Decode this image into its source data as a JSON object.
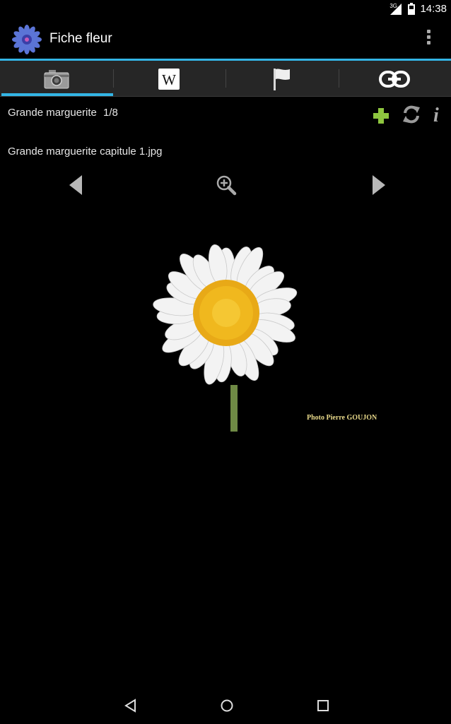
{
  "status_bar": {
    "network": "3G",
    "time": "14:38"
  },
  "app": {
    "title": "Fiche fleur",
    "icon": "cornflower-icon"
  },
  "tabs": [
    {
      "name": "photos",
      "icon": "camera-icon",
      "selected": true
    },
    {
      "name": "wikipedia",
      "icon": "wikipedia-icon",
      "selected": false
    },
    {
      "name": "flag",
      "icon": "flag-icon",
      "selected": false
    },
    {
      "name": "links",
      "icon": "link-icon",
      "selected": false
    }
  ],
  "content": {
    "species": "Grande marguerite",
    "counter": "1/8",
    "file_name": "Grande marguerite capitule 1.jpg",
    "info_glyph": "i",
    "photo_credit": "Photo Pierre GOUJON"
  },
  "colors": {
    "accent": "#33b5e5",
    "add": "#8ec63f",
    "background": "#000000",
    "tab_bar": "#262626"
  }
}
